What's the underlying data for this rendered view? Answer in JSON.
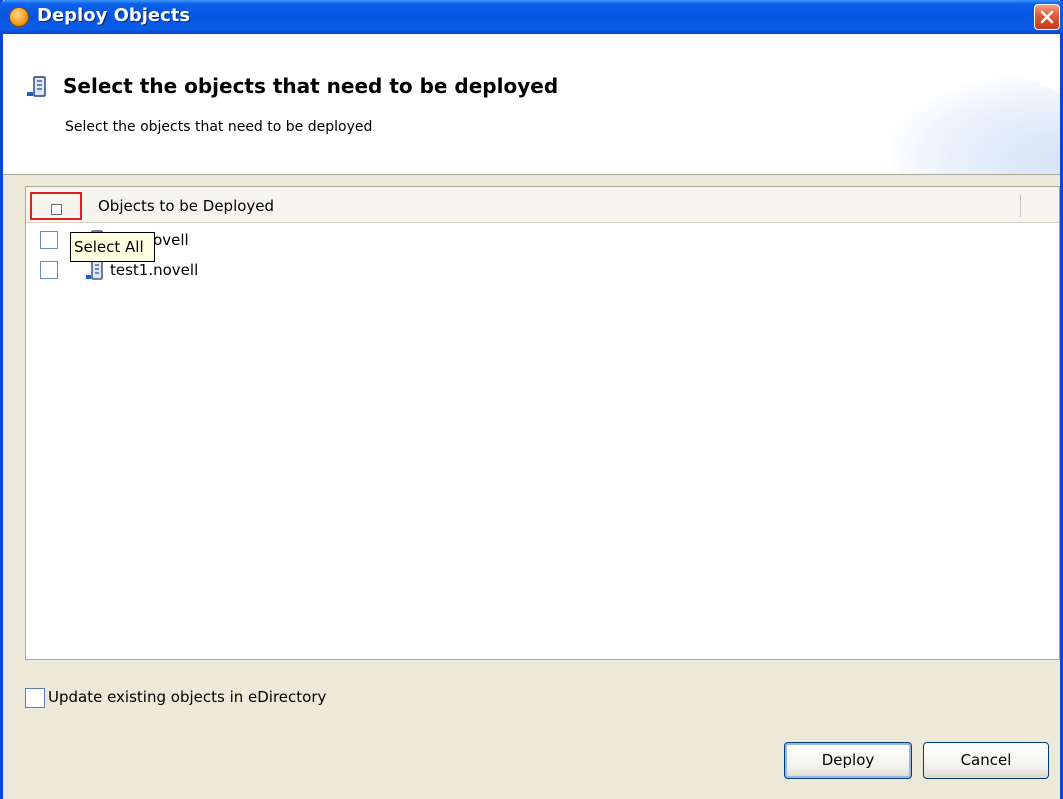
{
  "window": {
    "title": "Deploy Objects",
    "app_icon": "app-logo-icon",
    "close_icon": "close-icon"
  },
  "header": {
    "icon": "server-object-icon",
    "title": "Select the objects that need to be deployed",
    "subtitle": "Select the objects that need to be deployed"
  },
  "table": {
    "column_header": "Objects to be Deployed",
    "select_all_icon": "select-all-icon",
    "tooltip": "Select All",
    "rows": [
      {
        "label": "test.novell",
        "checked": false,
        "icon": "server-object-icon"
      },
      {
        "label": "test1.novell",
        "checked": false,
        "icon": "server-object-icon"
      }
    ]
  },
  "options": {
    "update_existing_label": "Update existing objects in eDirectory",
    "update_existing_checked": false
  },
  "buttons": {
    "deploy": "Deploy",
    "cancel": "Cancel"
  },
  "colors": {
    "title_bar": "#0a5ee8",
    "highlight_border": "#e02020",
    "dialog_background": "#ece9d8",
    "tooltip_background": "#ffffe1"
  }
}
